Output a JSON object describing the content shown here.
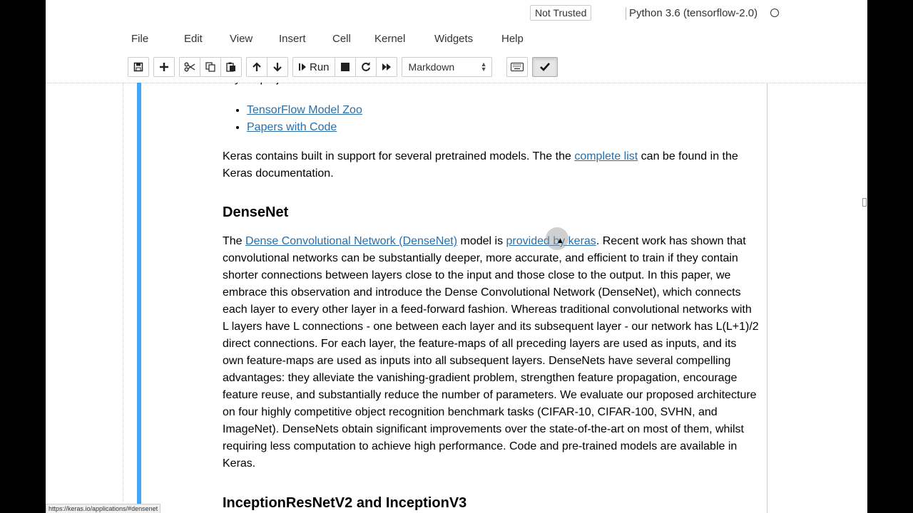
{
  "header": {
    "trusted_label": "Not Trusted",
    "kernel_name": "Python 3.6 (tensorflow-2.0)"
  },
  "menu": [
    "File",
    "Edit",
    "View",
    "Insert",
    "Cell",
    "Kernel",
    "Widgets",
    "Help"
  ],
  "toolbar": {
    "run_label": "Run",
    "cell_type": "Markdown",
    "icons": [
      "save-icon",
      "plus-icon",
      "cut-icon",
      "copy-icon",
      "paste-icon",
      "arrow-up-icon",
      "arrow-down-icon",
      "step-forward-icon",
      "stop-icon",
      "restart-icon",
      "fast-forward-icon",
      "keyboard-icon",
      "checkmark-icon"
    ]
  },
  "cell": {
    "clipped_text": "in your projects.",
    "links": [
      "TensorFlow Model Zoo",
      "Papers with Code"
    ],
    "para1": {
      "before": "Keras contains built in support for several pretrained models. The the ",
      "link": "complete list",
      "after": " can be found in the Keras documentation."
    },
    "heading_densenet": "DenseNet",
    "para2": {
      "before": "The ",
      "link1": "Dense Convolutional Network (DenseNet)",
      "middle": " model is ",
      "link2": "provided by keras",
      "after": ". Recent work has shown that convolutional networks can be substantially deeper, more accurate, and efficient to train if they contain shorter connections between layers close to the input and those close to the output. In this paper, we embrace this observation and introduce the Dense Convolutional Network (DenseNet), which connects each layer to every other layer in a feed-forward fashion. Whereas traditional convolutional networks with L layers have L connections - one between each layer and its subsequent layer - our network has L(L+1)/2 direct connections. For each layer, the feature-maps of all preceding layers are used as inputs, and its own feature-maps are used as inputs into all subsequent layers. DenseNets have several compelling advantages: they alleviate the vanishing-gradient problem, strengthen feature propagation, encourage feature reuse, and substantially reduce the number of parameters. We evaluate our proposed architecture on four highly competitive object recognition benchmark tasks (CIFAR-10, CIFAR-100, SVHN, and ImageNet). DenseNets obtain significant improvements over the state-of-the-art on most of them, whilst requiring less computation to achieve high performance. Code and pre-trained models are available in Keras."
    },
    "heading_inception": "InceptionResNetV2 and InceptionV3"
  },
  "status_url": "https://keras.io/applications/#densenet",
  "colors": {
    "link": "#296eaa",
    "cell_bar": "#42a5f5"
  }
}
